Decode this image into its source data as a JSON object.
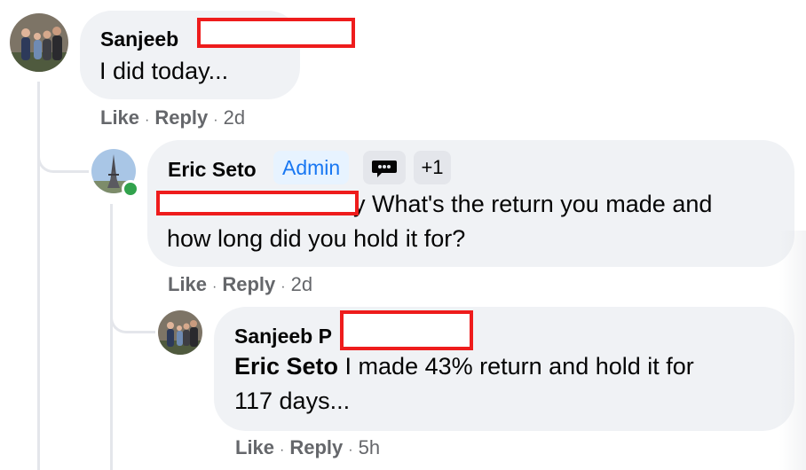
{
  "comments": [
    {
      "author": "Sanjeeb",
      "text": "I did today...",
      "actions": {
        "like": "Like",
        "reply": "Reply",
        "time": "2d"
      }
    },
    {
      "author": "Eric Seto",
      "badge": "Admin",
      "badge_extra": "+1",
      "text_line1": "y What's the return you made and",
      "text_line2": "how long did you hold it for?",
      "actions": {
        "like": "Like",
        "reply": "Reply",
        "time": "2d"
      }
    },
    {
      "author": "Sanjeeb P",
      "mention": "Eric Seto",
      "text_line1": " I made 43% return and hold it for",
      "text_line2": "117 days...",
      "actions": {
        "like": "Like",
        "reply": "Reply",
        "time": "5h"
      }
    }
  ],
  "separator": "·",
  "colors": {
    "bubble": "#f0f2f5",
    "secondary_text": "#65676b",
    "admin_badge_bg": "#e7f3ff",
    "admin_badge_text": "#1877f2",
    "redaction": "#ee1c1c",
    "online": "#31a24c"
  }
}
